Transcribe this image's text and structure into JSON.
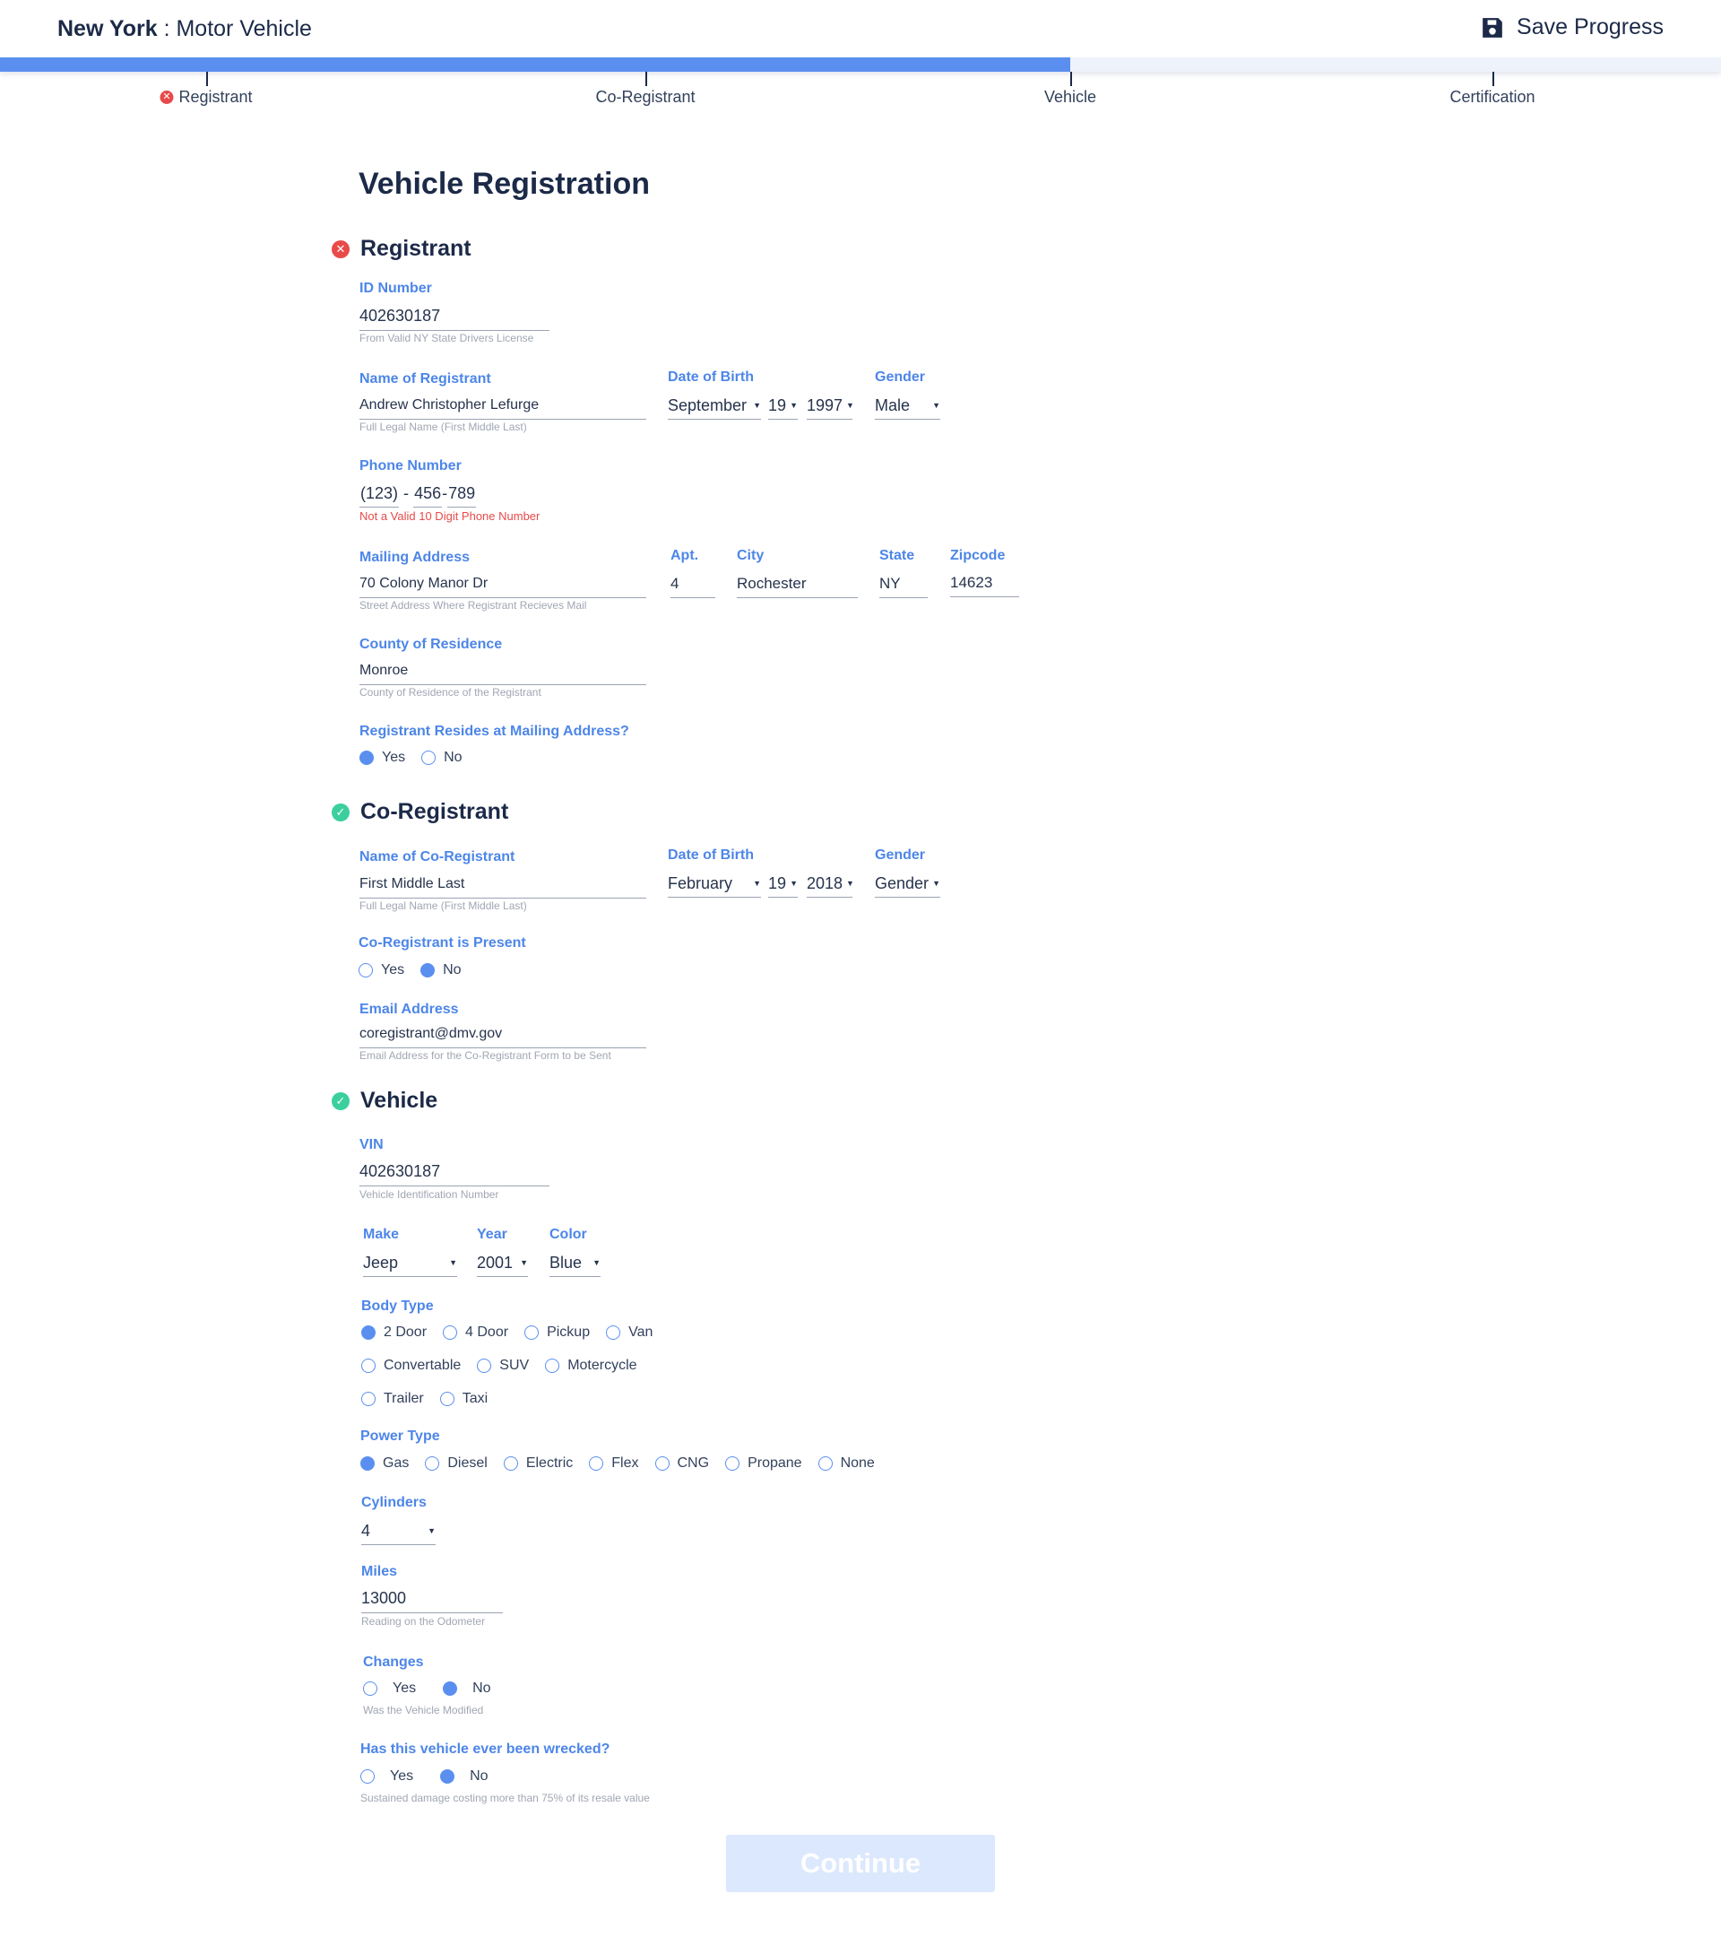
{
  "header": {
    "state": "New York",
    "separator": " : ",
    "agency": "Motor Vehicle",
    "save_label": "Save Progress"
  },
  "progress": {
    "fraction": 0.622
  },
  "steps": [
    "Registrant",
    "Co-Registrant",
    "Vehicle",
    "Certification"
  ],
  "page_title": "Vehicle Registration",
  "registrant": {
    "heading": "Registrant",
    "id_label": "ID Number",
    "id_value": "402630187",
    "id_hint": "From Valid NY State Drivers License",
    "name_label": "Name of Registrant",
    "name_value": "Andrew Christopher Lefurge",
    "name_hint": "Full Legal Name (First Middle Last)",
    "dob_label": "Date of Birth",
    "dob_month": "September",
    "dob_day": "19",
    "dob_year": "1997",
    "gender_label": "Gender",
    "gender_value": "Male",
    "phone_label": "Phone Number",
    "phone_area": "(123)",
    "phone_sep1": "-",
    "phone_prefix": "456",
    "phone_sep2": "-",
    "phone_line": "789",
    "phone_error": "Not a Valid 10 Digit Phone Number",
    "address_label": "Mailing Address",
    "address_value": "70 Colony Manor Dr",
    "address_hint": "Street Address Where Registrant Recieves Mail",
    "apt_label": "Apt.",
    "apt_value": "4",
    "city_label": "City",
    "city_value": "Rochester",
    "state_label": "State",
    "state_value": "NY",
    "zip_label": "Zipcode",
    "zip_value": "14623",
    "county_label": "County of Residence",
    "county_value": "Monroe",
    "county_hint": "County of Residence of the Registrant",
    "resides_label": "Registrant Resides at Mailing Address?",
    "yes": "Yes",
    "no": "No",
    "resides_selected": "Yes"
  },
  "coregistrant": {
    "heading": "Co-Registrant",
    "name_label": "Name of Co-Registrant",
    "name_value": "First Middle Last",
    "name_hint": "Full Legal Name (First Middle Last)",
    "dob_label": "Date of Birth",
    "dob_month": "February",
    "dob_day": "19",
    "dob_year": "2018",
    "gender_label": "Gender",
    "gender_value": "Gender",
    "present_label": "Co-Registrant is Present",
    "yes": "Yes",
    "no": "No",
    "present_selected": "No",
    "email_label": "Email Address",
    "email_value": "coregistrant@dmv.gov",
    "email_hint": "Email Address for the Co-Registrant Form to be Sent"
  },
  "vehicle": {
    "heading": "Vehicle",
    "vin_label": "VIN",
    "vin_value": "402630187",
    "vin_hint": "Vehicle Identification Number",
    "make_label": "Make",
    "make_value": "Jeep",
    "year_label": "Year",
    "year_value": "2001",
    "color_label": "Color",
    "color_value": "Blue",
    "body_label": "Body Type",
    "body_options": [
      "2 Door",
      "4 Door",
      "Pickup",
      "Van",
      "Convertable",
      "SUV",
      "Motercycle",
      "Trailer",
      "Taxi"
    ],
    "body_selected": "2 Door",
    "power_label": "Power Type",
    "power_options": [
      "Gas",
      "Diesel",
      "Electric",
      "Flex",
      "CNG",
      "Propane",
      "None"
    ],
    "power_selected": "Gas",
    "cyl_label": "Cylinders",
    "cyl_value": "4",
    "miles_label": "Miles",
    "miles_value": "13000",
    "miles_hint": "Reading on the Odometer",
    "changes_label": "Changes",
    "changes_selected": "No",
    "changes_hint": "Was the Vehicle Modified",
    "wrecked_label": "Has this vehicle ever been wrecked?",
    "wrecked_selected": "No",
    "wrecked_hint": "Sustained damage costing more than 75% of its resale value",
    "yes": "Yes",
    "no": "No"
  },
  "continue_label": "Continue",
  "colors": {
    "accent": "#5a8ff0",
    "label": "#4d86e8",
    "error": "#e84a4a",
    "success": "#3ccf9e",
    "title": "#1c2a48"
  },
  "icons": {
    "save": "floppy-disk",
    "error": "x-circle",
    "success": "check-circle"
  }
}
